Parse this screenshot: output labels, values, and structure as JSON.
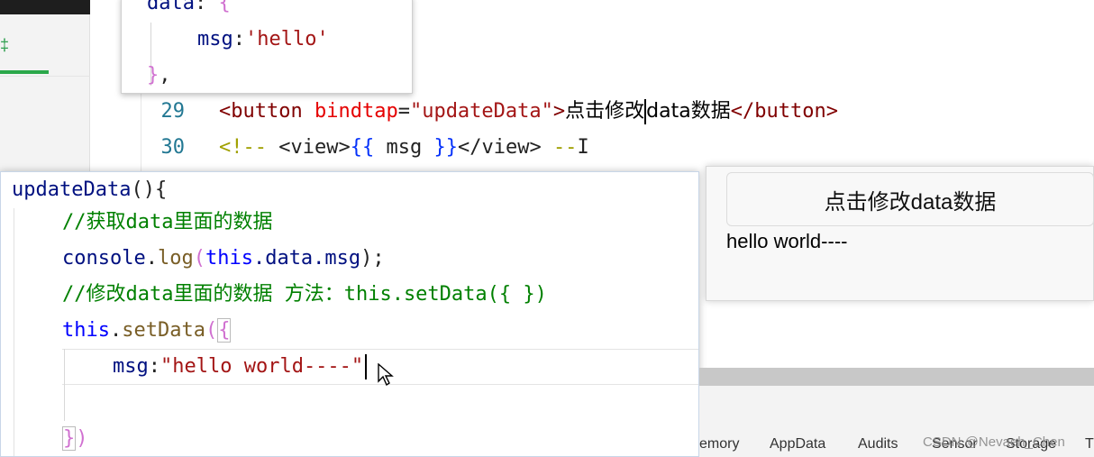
{
  "sidebar": {
    "tab_glyph": "‡"
  },
  "editor": {
    "line29": {
      "num": "29",
      "open_tag": "button",
      "attr": "bindtap",
      "attr_val": "\"updateData\"",
      "text_before": "点击修改",
      "text_after": "data数据",
      "close_tag": "button"
    },
    "line30": {
      "num": "30",
      "comment_open": "<!--",
      "view_open": "<view>",
      "brace_open": "{{",
      "expr": "msg",
      "brace_close": "}}",
      "view_close": "</view>",
      "comment_close": "--",
      "tail": "I"
    }
  },
  "popup_data": {
    "line1_key": "data",
    "line1_punc": ":",
    "line1_brace": "{",
    "line2_key": "msg",
    "line2_punc": ":",
    "line2_val": "'hello'",
    "line3_brace": "}",
    "line3_punc": ","
  },
  "popup_js": {
    "l1_fn": "updateData",
    "l1_punc": "(){",
    "l2_comment": "//获取data里面的数据",
    "l3_obj": "console",
    "l3_dot1": ".",
    "l3_method": "log",
    "l3_paren": "(",
    "l3_kw": "this",
    "l3_rest": ".data.msg",
    "l3_close": ");",
    "l4_comment": "//修改data里面的数据  方法：this.setData({ })",
    "l5_kw": "this",
    "l5_dot": ".",
    "l5_method": "setData",
    "l5_paren": "(",
    "l5_brace": "{",
    "l6_key": "msg",
    "l6_punc": ":",
    "l6_val": "\"hello world----\"",
    "l8_brace": "}",
    "l8_paren": ")"
  },
  "preview": {
    "button_label": "点击修改data数据",
    "msg_text": "hello world----"
  },
  "devtools": {
    "tabs": [
      "emory",
      "AppData",
      "Audits",
      "Sensor",
      "Storage",
      "T"
    ]
  },
  "watermark": "CSDN @Nevaeh_Chen"
}
